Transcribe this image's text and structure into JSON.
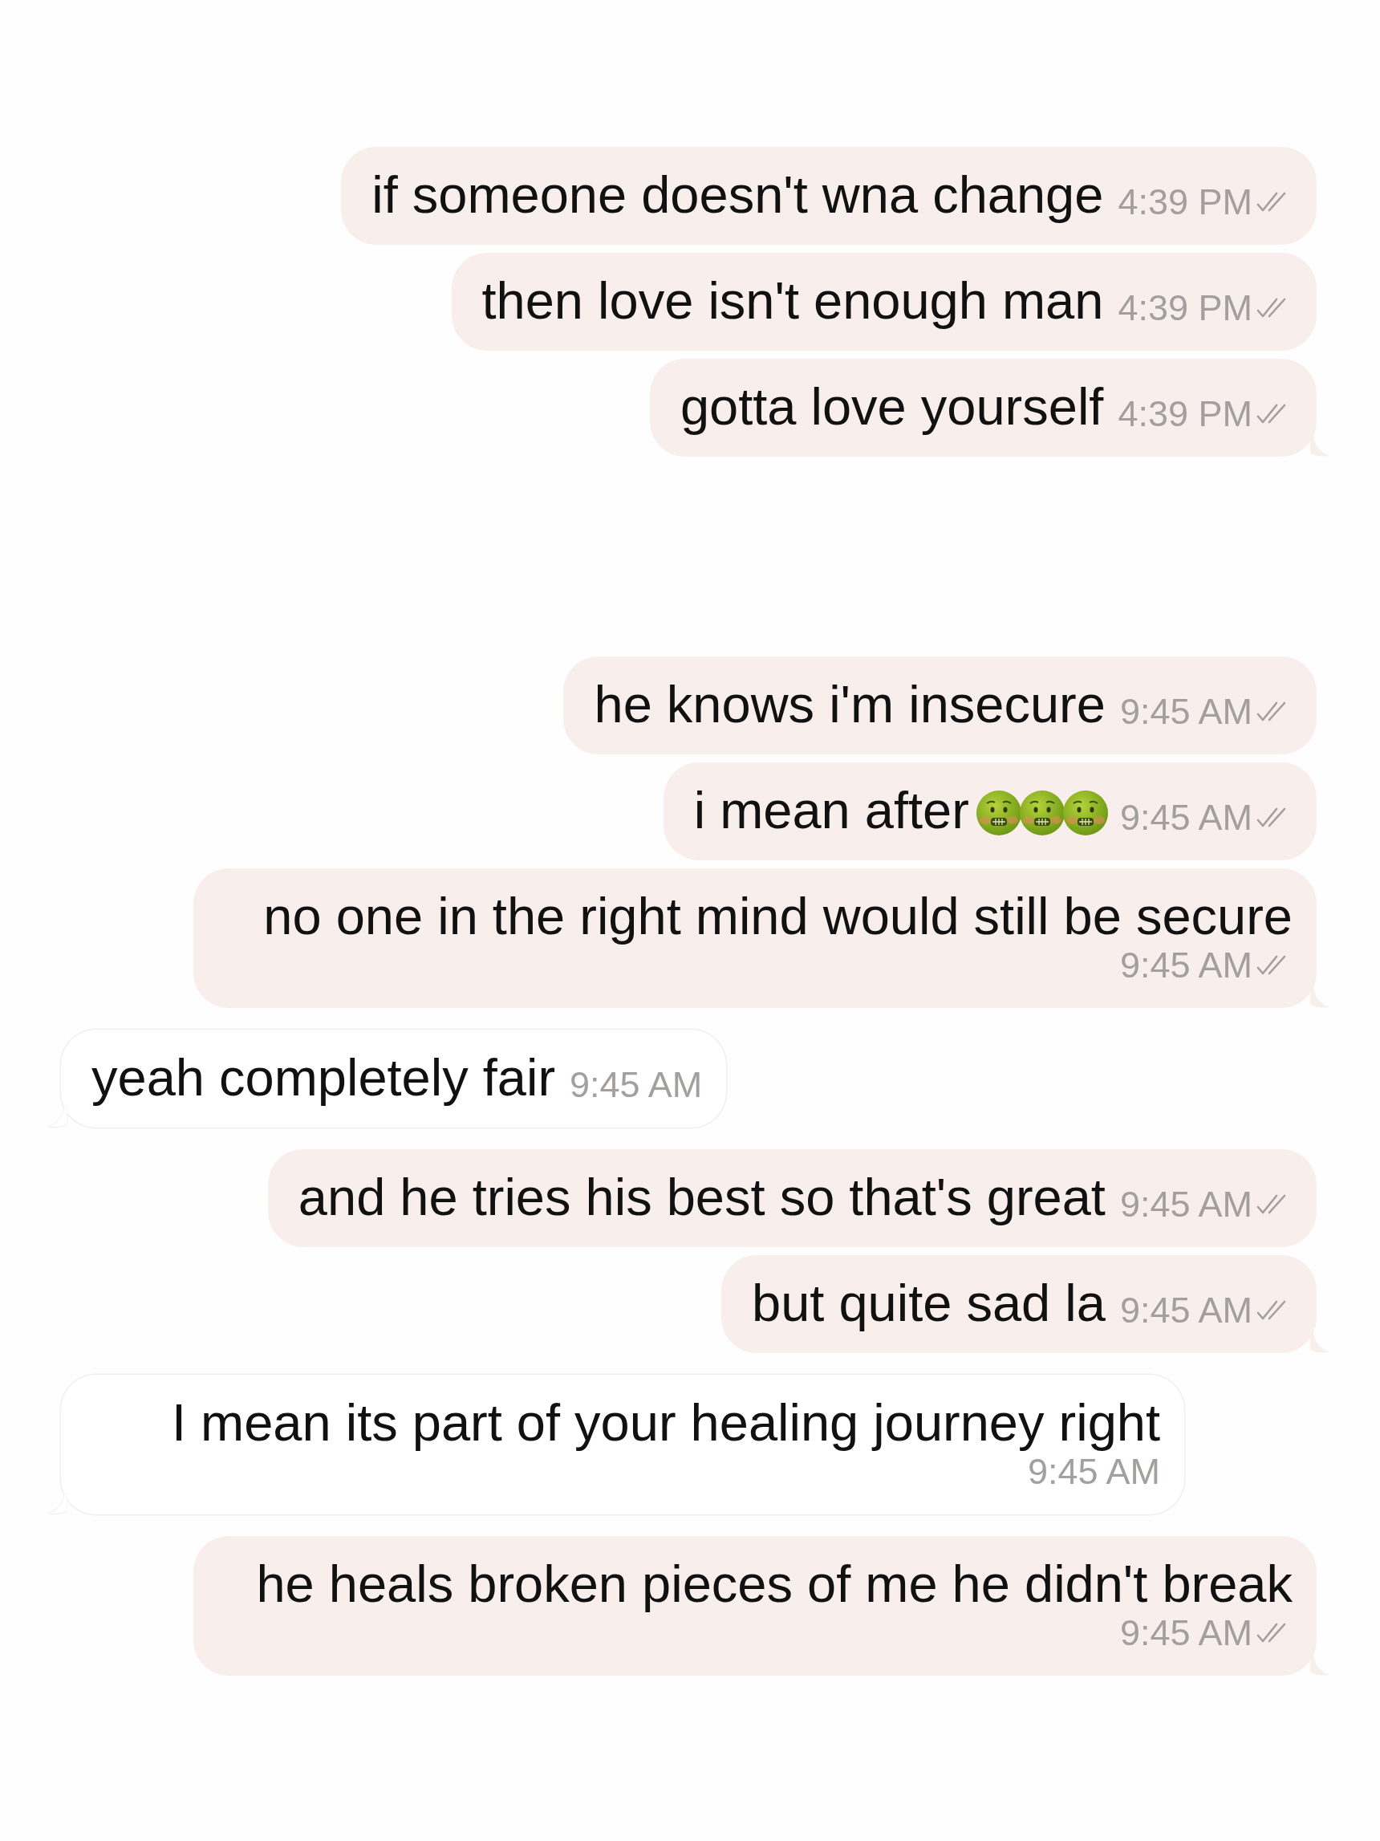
{
  "groups": [
    {
      "messages": [
        {
          "kind": "sent",
          "text": "if someone doesn't wna change",
          "time": "4:39 PM",
          "tail": false
        },
        {
          "kind": "sent",
          "text": "then love isn't enough man",
          "time": "4:39 PM",
          "tail": false
        },
        {
          "kind": "sent",
          "text": "gotta love yourself",
          "time": "4:39 PM",
          "tail": true
        }
      ]
    },
    {
      "messages": [
        {
          "kind": "sent",
          "text": "he knows i'm insecure",
          "time": "9:45 AM",
          "tail": false
        },
        {
          "kind": "sent",
          "text": "i mean after",
          "attachments": [
            {
              "kind": "emoji"
            },
            {
              "kind": "emoji"
            },
            {
              "kind": "emoji"
            }
          ],
          "time": "9:45 AM",
          "tail": false
        },
        {
          "kind": "sent",
          "text": "no one in the right mind would still be secure",
          "time": "9:45 AM",
          "tail": true
        },
        {
          "kind": "received",
          "text": "yeah completely fair",
          "time": "9:45 AM",
          "tail": true
        },
        {
          "kind": "sent",
          "text": "and he tries his best so that's great",
          "time": "9:45 AM",
          "tail": false
        },
        {
          "kind": "sent",
          "text": "but quite sad la",
          "time": "9:45 AM",
          "tail": true
        },
        {
          "kind": "received",
          "text": "I mean its part of your healing journey right",
          "time": "9:45 AM",
          "tail": true
        },
        {
          "kind": "sent",
          "text": "he heals broken pieces of me he didn't break",
          "time": "9:45 AM",
          "tail": true
        }
      ]
    }
  ]
}
